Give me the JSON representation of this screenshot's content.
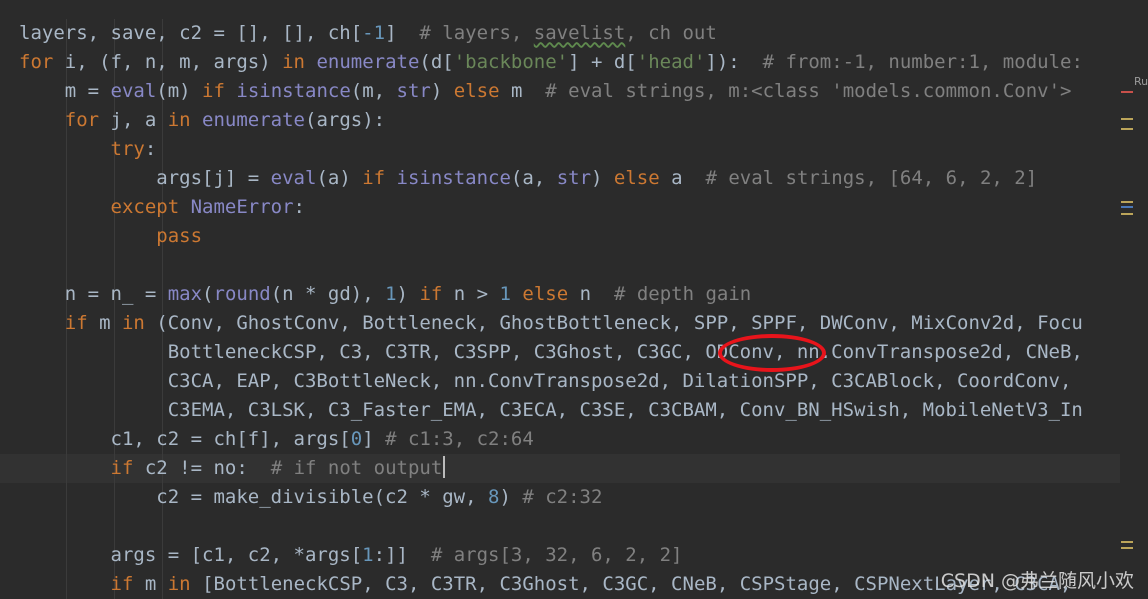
{
  "code_lines": [
    {
      "segments": [
        [
          "t",
          "layers, save, c2 = [], [], ch["
        ],
        [
          "n",
          "-1"
        ],
        [
          "t",
          "]  "
        ],
        [
          "c",
          "# layers, "
        ],
        [
          "cs",
          "savelist"
        ],
        [
          "c",
          ", ch out"
        ]
      ]
    },
    {
      "segments": [
        [
          "k",
          "for "
        ],
        [
          "t",
          "i, (f, n, m, args) "
        ],
        [
          "k",
          "in "
        ],
        [
          "b",
          "enumerate"
        ],
        [
          "t",
          "(d["
        ],
        [
          "s",
          "'backbone'"
        ],
        [
          "t",
          "] + d["
        ],
        [
          "s",
          "'head'"
        ],
        [
          "t",
          "]):  "
        ],
        [
          "c",
          "# from:-1, number:1, module:"
        ]
      ]
    },
    {
      "segments": [
        [
          "t",
          "    m = "
        ],
        [
          "b",
          "eval"
        ],
        [
          "t",
          "(m) "
        ],
        [
          "k",
          "if "
        ],
        [
          "b",
          "isinstance"
        ],
        [
          "t",
          "(m, "
        ],
        [
          "b",
          "str"
        ],
        [
          "t",
          ") "
        ],
        [
          "k",
          "else "
        ],
        [
          "t",
          "m  "
        ],
        [
          "c",
          "# eval strings, m:<class 'models.common.Conv'>"
        ]
      ]
    },
    {
      "segments": [
        [
          "k",
          "    for "
        ],
        [
          "t",
          "j, a "
        ],
        [
          "k",
          "in "
        ],
        [
          "b",
          "enumerate"
        ],
        [
          "t",
          "(args):"
        ]
      ]
    },
    {
      "segments": [
        [
          "k",
          "        try"
        ],
        [
          "t",
          ":"
        ]
      ]
    },
    {
      "segments": [
        [
          "t",
          "            args[j] = "
        ],
        [
          "b",
          "eval"
        ],
        [
          "t",
          "(a) "
        ],
        [
          "k",
          "if "
        ],
        [
          "b",
          "isinstance"
        ],
        [
          "t",
          "(a, "
        ],
        [
          "b",
          "str"
        ],
        [
          "t",
          ") "
        ],
        [
          "k",
          "else "
        ],
        [
          "t",
          "a  "
        ],
        [
          "c",
          "# eval strings, [64, 6, 2, 2]"
        ]
      ]
    },
    {
      "segments": [
        [
          "k",
          "        except "
        ],
        [
          "b",
          "NameError"
        ],
        [
          "t",
          ":"
        ]
      ]
    },
    {
      "segments": [
        [
          "k",
          "            pass"
        ]
      ]
    },
    {
      "segments": []
    },
    {
      "segments": [
        [
          "t",
          "    n = n_ = "
        ],
        [
          "b",
          "max"
        ],
        [
          "t",
          "("
        ],
        [
          "b",
          "round"
        ],
        [
          "t",
          "(n * gd), "
        ],
        [
          "n",
          "1"
        ],
        [
          "t",
          ") "
        ],
        [
          "k",
          "if "
        ],
        [
          "t",
          "n > "
        ],
        [
          "n",
          "1 "
        ],
        [
          "k",
          "else "
        ],
        [
          "t",
          "n  "
        ],
        [
          "c",
          "# depth gain"
        ]
      ]
    },
    {
      "segments": [
        [
          "k",
          "    if "
        ],
        [
          "t",
          "m "
        ],
        [
          "k",
          "in "
        ],
        [
          "t",
          "(Conv, GhostConv, Bottleneck, GhostBottleneck, SPP, SPPF, DWConv, MixConv2d, Focu"
        ]
      ]
    },
    {
      "segments": [
        [
          "t",
          "             BottleneckCSP, C3, C3TR, C3SPP, C3Ghost, C3GC, ODConv, nn.ConvTranspose2d, CNeB,"
        ]
      ]
    },
    {
      "segments": [
        [
          "t",
          "             C3CA, EAP, C3BottleNeck, nn.ConvTranspose2d, DilationSPP, C3CABlock, CoordConv,"
        ]
      ]
    },
    {
      "segments": [
        [
          "t",
          "             C3EMA, C3LSK, C3_Faster_EMA, C3ECA, C3SE, C3CBAM, Conv_BN_HSwish, MobileNetV3_In"
        ]
      ]
    },
    {
      "segments": [
        [
          "t",
          "        c1, c2 = ch[f], args["
        ],
        [
          "n",
          "0"
        ],
        [
          "t",
          "] "
        ],
        [
          "c",
          "# c1:3, c2:64"
        ]
      ]
    },
    {
      "segments": [
        [
          "k",
          "        if "
        ],
        [
          "t",
          "c2 != no:  "
        ],
        [
          "c",
          "# if not output"
        ],
        [
          "caret",
          ""
        ]
      ],
      "current": true
    },
    {
      "segments": [
        [
          "t",
          "            c2 = make_divisible(c2 * gw, "
        ],
        [
          "n",
          "8"
        ],
        [
          "t",
          ") "
        ],
        [
          "c",
          "# c2:32"
        ]
      ]
    },
    {
      "segments": []
    },
    {
      "segments": [
        [
          "t",
          "        args = [c1, c2, *args["
        ],
        [
          "n",
          "1"
        ],
        [
          "t",
          ":]]  "
        ],
        [
          "c",
          "# args[3, 32, 6, 2, 2]"
        ]
      ]
    },
    {
      "segments": [
        [
          "k",
          "        if "
        ],
        [
          "t",
          "m "
        ],
        [
          "k",
          "in "
        ],
        [
          "t",
          "[BottleneckCSP, C3, C3TR, C3Ghost, C3GC, CNeB, CSPStage, CSPNextLayer, C3CA,"
        ]
      ]
    }
  ],
  "right_gutter_label": "Ru",
  "watermark": "CSDN @弗兰随风小欢",
  "colors": {
    "background": "#2b2b2b",
    "current_line": "#323232",
    "keyword": "#cc7832",
    "builtin": "#8888c6",
    "string": "#6a8759",
    "number": "#6897bb",
    "comment": "#808080",
    "text": "#a9b7c6",
    "highlight_ellipse": "#e8141b"
  },
  "gutter_markers": [
    {
      "color": "#c8504a"
    },
    {
      "color": "#bca55a"
    },
    {
      "color": "#bca55a"
    },
    {
      "color": "#bca55a"
    },
    {
      "color": "#4a78b8"
    },
    {
      "color": "#bca55a"
    },
    {
      "color": "#bca55a"
    },
    {
      "color": "#bca55a"
    }
  ]
}
